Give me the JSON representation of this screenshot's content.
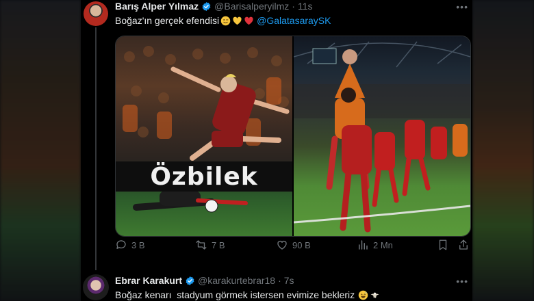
{
  "tweet1": {
    "author_name": "Barış Alper Yılmaz",
    "handle": "@Barisalperyilmz",
    "separator": "·",
    "time": "11s",
    "text": "Boğaz'ın gerçek efendisi",
    "mention": "@GalatasaraySK",
    "emojis": [
      "winking-face",
      "yellow-heart",
      "red-heart"
    ],
    "sponsor_text": "Özbilek",
    "stats": {
      "replies": "3 B",
      "retweets": "7 B",
      "likes": "90 B",
      "views": "2 Mn"
    }
  },
  "tweet2": {
    "author_name": "Ebrar Karakurt",
    "handle": "@karakurtebrar18",
    "separator": "·",
    "time": "7s",
    "text": "Boğaz kenarı  stadyum görmek istersen evimize bekleriz",
    "emojis": [
      "grinning-sweat-face",
      "eagle"
    ]
  },
  "colors": {
    "accent": "#1d9bf0",
    "muted": "#71767b",
    "text": "#e7e9ea",
    "background": "#000000"
  }
}
